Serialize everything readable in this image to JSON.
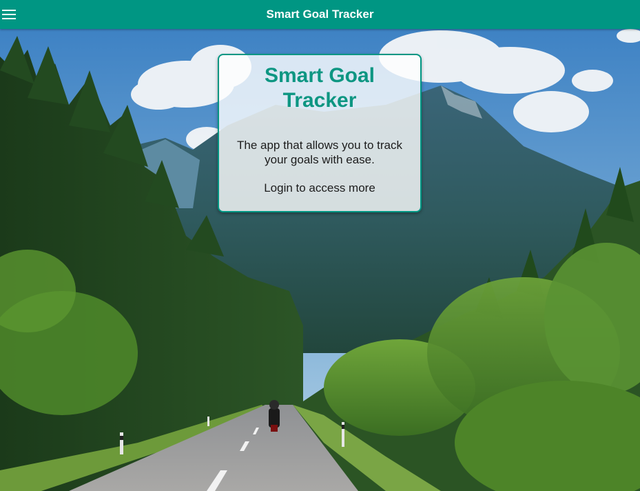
{
  "toolbar": {
    "title": "Smart Goal Tracker",
    "menu_icon": "hamburger-menu-icon",
    "background_color": "#009683",
    "text_color": "#ffffff"
  },
  "hero_image": {
    "subject": "mountain road with pine forest and motorcyclist"
  },
  "card": {
    "title": "Smart Goal Tracker",
    "description": "The app that allows you to track your goals with ease.",
    "login_prompt": "Login to access more",
    "title_color": "#0d9682",
    "border_color": "#009683"
  }
}
